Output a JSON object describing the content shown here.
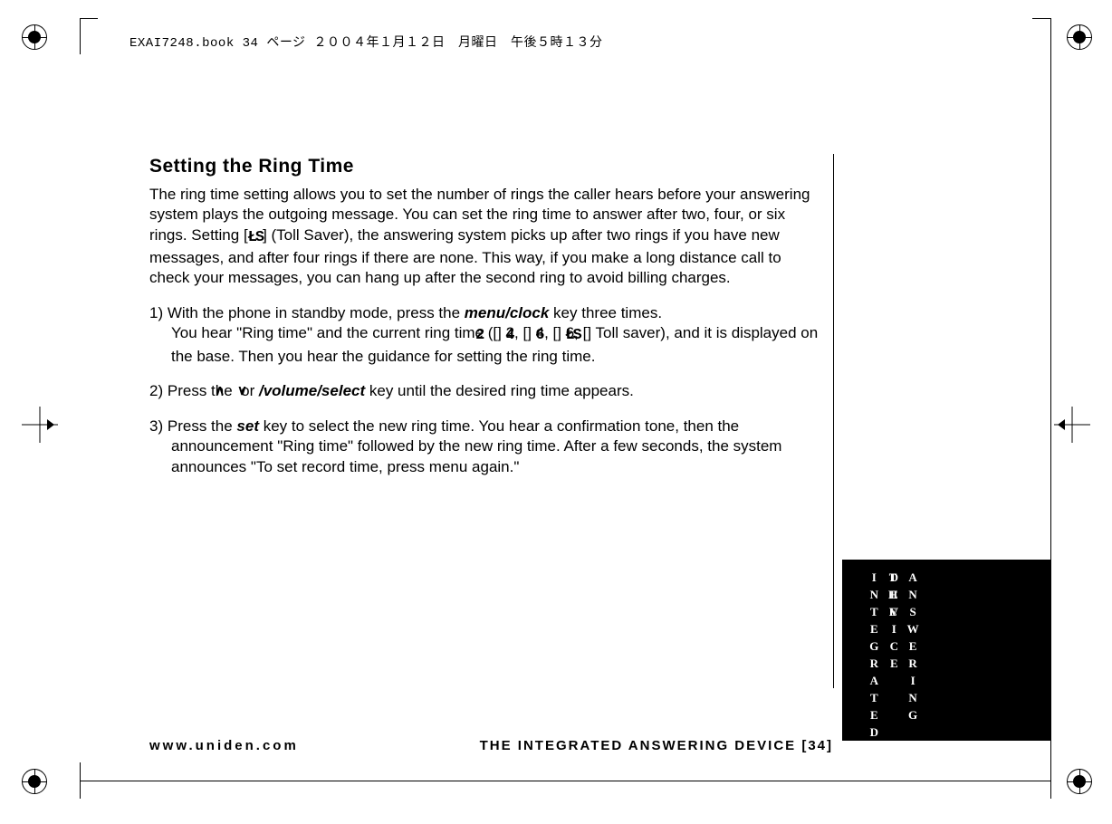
{
  "meta_line": "EXAI7248.book  34 ページ  ２００４年１月１２日　月曜日　午後５時１３分",
  "heading": "Setting the Ring Time",
  "intro_pre": "The ring time setting allows you to set the number of rings the caller hears before your answering system plays the outgoing message. You can set the ring time to answer after two, four, or six rings. Setting [",
  "intro_ts": "ŁS",
  "intro_post": "] (Toll Saver), the answering system picks up after two rings if you have new messages, and after four rings if there are none. This way, if you make a long distance call to check your messages, you can hang up after the second ring to avoid billing charges.",
  "step1": {
    "num": "1)",
    "a": "With the phone in standby mode, press the ",
    "key": "menu/clock",
    "b": " key three times.",
    "c": "You hear \"Ring time\" and the current ring time ([",
    "d2": "2",
    "m2": "] 2, [",
    "d4": "4",
    "m4": "] 4, [",
    "d6": "6",
    "m6": "] 6, [",
    "dts": "ŁS",
    "e": "] Toll saver), and it is displayed on the base. Then you hear the guidance for setting the ring time."
  },
  "step2": {
    "num": "2)",
    "a": "Press the ",
    "up": "∧",
    "b": " or ",
    "down": "∨",
    "key": "/volume/select",
    "c": " key until the desired ring time appears."
  },
  "step3": {
    "num": "3)",
    "a": "Press the ",
    "key": "set",
    "b": " key to select the new ring time. You hear a confirmation tone, then the announcement \"Ring time\" followed by the new ring time. After a few seconds, the system announces \"To set record time, press menu again.\""
  },
  "footer_left": "www.uniden.com",
  "footer_right": "THE INTEGRATED ANSWERING DEVICE [34]",
  "tab_line1": "THE INTEGRATED",
  "tab_line2": "ANSWERING DEVICE"
}
